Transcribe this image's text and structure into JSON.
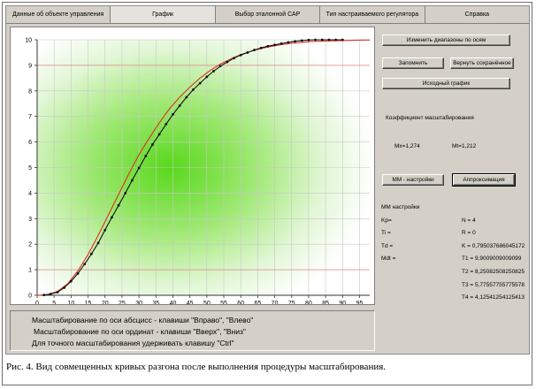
{
  "tabs": [
    {
      "label": "Данные об объекте управления",
      "active": false
    },
    {
      "label": "График",
      "active": true
    },
    {
      "label": "Выбор эталонной САР",
      "active": false
    },
    {
      "label": "Тип настраиваемого регулятора",
      "active": false
    },
    {
      "label": "Справка",
      "active": false
    }
  ],
  "buttons": {
    "change_ranges": "Изменить диапазоны по осям",
    "remember": "Запомнить",
    "restore": "Вернуть сохранённое",
    "original": "Исходный график",
    "mm_settings": "ММ - настройки",
    "approximation": "Аппроксимация"
  },
  "scale": {
    "title": "Коэффициент масштабирования",
    "mx": "Mx=1,274",
    "mt": "Mt=1,212"
  },
  "mm": {
    "title": "ММ настройки",
    "kp": "Kp=",
    "ti": "Ti =",
    "td": "Td =",
    "mdt": "Mdt =",
    "n": "N = 4",
    "r": "R = 0",
    "k": "K = 0,795037686045172",
    "t1": "T1 = 9,9009009009099",
    "t2": "T2 = 8,25082508250825",
    "t3": "T3 = 5,77557755775578",
    "t4": "T4 = 4,12541254125413"
  },
  "hints": {
    "line1": "Масштабирование по оси абсцисс - клавиши \"Вправо\", \"Влево\"",
    "line2": "Масштабирование по оси ординат - клавиши \"Вверх\", \"Вниз\"",
    "line3": "Для точного масштабирования удерживать клавишу \"Ctrl\""
  },
  "caption": "Рис. 4. Вид совмещенных кривых разгона после выполнения процедуры масштабирования.",
  "chart_data": {
    "type": "line",
    "xlim": [
      0,
      98
    ],
    "ylim": [
      0,
      10
    ],
    "x_ticks": [
      0,
      5,
      10,
      15,
      20,
      25,
      30,
      35,
      40,
      45,
      50,
      55,
      60,
      65,
      70,
      75,
      80,
      85,
      90,
      95
    ],
    "y_ticks": [
      0,
      1,
      2,
      3,
      4,
      5,
      6,
      7,
      8,
      9,
      10
    ],
    "grid": true,
    "series": [
      {
        "color": "#e0301e",
        "marker": false,
        "x": [
          0,
          3,
          6,
          9,
          12,
          15,
          18,
          21,
          24,
          27,
          30,
          33,
          36,
          39,
          42,
          45,
          48,
          51,
          54,
          57,
          60,
          63,
          66,
          69,
          72,
          75,
          78,
          81,
          84,
          87,
          90,
          93,
          96,
          98
        ],
        "y": [
          0,
          0.02,
          0.15,
          0.45,
          0.95,
          1.6,
          2.35,
          3.15,
          3.95,
          4.75,
          5.5,
          6.15,
          6.75,
          7.3,
          7.75,
          8.15,
          8.5,
          8.8,
          9.05,
          9.25,
          9.42,
          9.55,
          9.66,
          9.74,
          9.81,
          9.86,
          9.9,
          9.93,
          9.95,
          9.96,
          9.97,
          9.98,
          9.99,
          9.99
        ]
      },
      {
        "color": "#111111",
        "marker": true,
        "x": [
          2,
          4,
          6,
          8,
          10,
          12,
          14,
          16,
          18,
          20,
          22,
          24,
          26,
          28,
          30,
          32,
          34,
          36,
          38,
          40,
          42,
          44,
          46,
          48,
          50,
          52,
          54,
          56,
          58,
          60,
          62,
          64,
          66,
          68,
          70,
          72,
          74,
          76,
          78,
          80,
          82,
          84,
          86,
          88,
          90
        ],
        "y": [
          0.01,
          0.05,
          0.12,
          0.3,
          0.55,
          0.85,
          1.22,
          1.62,
          2.05,
          2.55,
          3.05,
          3.52,
          4.0,
          4.5,
          4.98,
          5.45,
          5.9,
          6.3,
          6.7,
          7.08,
          7.42,
          7.75,
          8.05,
          8.3,
          8.55,
          8.77,
          8.97,
          9.13,
          9.28,
          9.4,
          9.5,
          9.6,
          9.68,
          9.75,
          9.8,
          9.85,
          9.9,
          9.94,
          9.97,
          9.99,
          10.0,
          10.0,
          10.0,
          10.0,
          10.0
        ]
      }
    ]
  }
}
